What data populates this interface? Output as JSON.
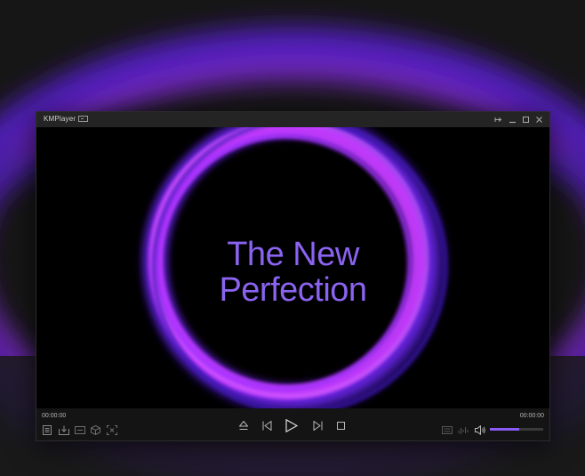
{
  "window": {
    "title": "KMPlayer"
  },
  "video": {
    "headline_line1": "The New",
    "headline_line2": "Perfection"
  },
  "controls": {
    "elapsed": "00:00:00",
    "duration": "00:00:00",
    "volume": 0.55
  },
  "colors": {
    "accent": "#8a5cf5",
    "ring_magenta": "#c93cff",
    "ring_violet": "#7a2cff",
    "background": "#161616"
  },
  "icons": [
    "menu-icon",
    "capture-icon",
    "subtitle-icon",
    "3d-icon",
    "screen-ratio-icon",
    "eject-icon",
    "previous-icon",
    "play-icon",
    "next-icon",
    "stop-icon",
    "keyboard-icon",
    "equalizer-icon",
    "speaker-icon",
    "pin-icon",
    "minimize-icon",
    "maximize-icon",
    "close-icon"
  ]
}
